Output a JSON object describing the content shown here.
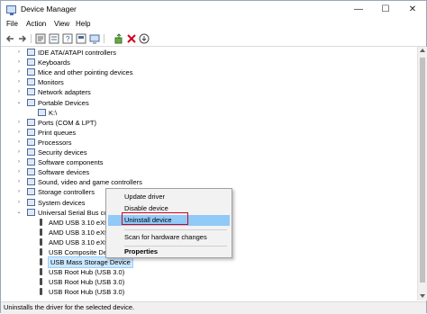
{
  "window": {
    "title": "Device Manager",
    "minimize_glyph": "—",
    "maximize_glyph": "☐",
    "close_glyph": "✕"
  },
  "menu": [
    "File",
    "Action",
    "View",
    "Help"
  ],
  "toolbar": [
    "back-arrow-icon",
    "forward-arrow-icon",
    "properties-icon",
    "view-icon",
    "help-icon",
    "monitor-icon",
    "update-driver-icon",
    "uninstall-icon",
    "download-icon"
  ],
  "tree": [
    {
      "label": "IDE ATA/ATAPI controllers",
      "expander": "›",
      "level": 1,
      "icon": "ide-controller-icon"
    },
    {
      "label": "Keyboards",
      "expander": "›",
      "level": 1,
      "icon": "keyboard-icon"
    },
    {
      "label": "Mice and other pointing devices",
      "expander": "›",
      "level": 1,
      "icon": "mouse-icon"
    },
    {
      "label": "Monitors",
      "expander": "›",
      "level": 1,
      "icon": "monitor-icon"
    },
    {
      "label": "Network adapters",
      "expander": "›",
      "level": 1,
      "icon": "network-adapter-icon"
    },
    {
      "label": "Portable Devices",
      "expander": "⌄",
      "level": 1,
      "icon": "portable-device-icon"
    },
    {
      "label": "K:\\",
      "expander": "",
      "level": 2,
      "icon": "drive-icon"
    },
    {
      "label": "Ports (COM & LPT)",
      "expander": "›",
      "level": 1,
      "icon": "port-icon"
    },
    {
      "label": "Print queues",
      "expander": "›",
      "level": 1,
      "icon": "printer-icon"
    },
    {
      "label": "Processors",
      "expander": "›",
      "level": 1,
      "icon": "processor-icon"
    },
    {
      "label": "Security devices",
      "expander": "›",
      "level": 1,
      "icon": "security-device-icon"
    },
    {
      "label": "Software components",
      "expander": "›",
      "level": 1,
      "icon": "software-component-icon"
    },
    {
      "label": "Software devices",
      "expander": "›",
      "level": 1,
      "icon": "software-device-icon"
    },
    {
      "label": "Sound, video and game controllers",
      "expander": "›",
      "level": 1,
      "icon": "sound-icon"
    },
    {
      "label": "Storage controllers",
      "expander": "›",
      "level": 1,
      "icon": "storage-controller-icon"
    },
    {
      "label": "System devices",
      "expander": "›",
      "level": 1,
      "icon": "system-device-icon"
    },
    {
      "label": "Universal Serial Bus con",
      "expander": "⌄",
      "level": 1,
      "icon": "usb-controller-icon"
    },
    {
      "label": "AMD USB 3.10 eXter",
      "expander": "",
      "level": 2,
      "icon": "usb-icon"
    },
    {
      "label": "AMD USB 3.10 eXter",
      "expander": "",
      "level": 2,
      "icon": "usb-icon"
    },
    {
      "label": "AMD USB 3.10 eXter",
      "expander": "",
      "level": 2,
      "icon": "usb-icon"
    },
    {
      "label": "USB Composite Dev",
      "expander": "",
      "level": 2,
      "icon": "usb-icon"
    },
    {
      "label": "USB Mass Storage Device",
      "expander": "",
      "level": 2,
      "icon": "usb-icon",
      "selected": true
    },
    {
      "label": "USB Root Hub (USB 3.0)",
      "expander": "",
      "level": 2,
      "icon": "usb-icon"
    },
    {
      "label": "USB Root Hub (USB 3.0)",
      "expander": "",
      "level": 2,
      "icon": "usb-icon"
    },
    {
      "label": "USB Root Hub (USB 3.0)",
      "expander": "",
      "level": 2,
      "icon": "usb-icon"
    }
  ],
  "context_menu": {
    "items": [
      "Update driver",
      "Disable device",
      "Uninstall device",
      "Scan for hardware changes",
      "Properties"
    ],
    "highlighted": "Uninstall device",
    "highlight_outline_color": "#d0021b"
  },
  "status": "Uninstalls the driver for the selected device."
}
